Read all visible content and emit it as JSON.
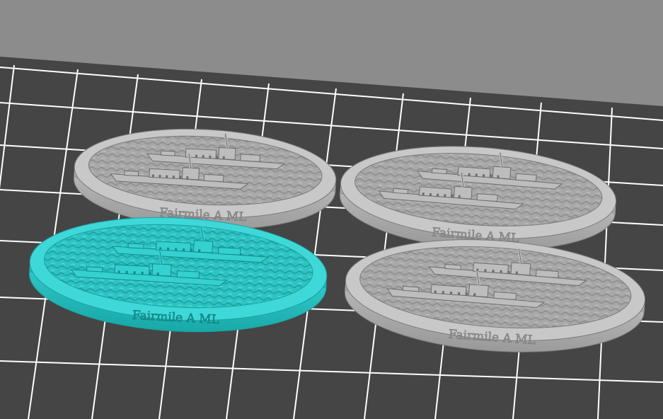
{
  "scene": {
    "background_color": "#8c8c8c",
    "bed_color": "#454545",
    "grid_color": "#ffffff",
    "model_color": "#b4b4b4",
    "selected_color": "#35d0d0"
  },
  "models": [
    {
      "name": "base-top-left",
      "label": "Fairmile A ML",
      "selected": false
    },
    {
      "name": "base-top-right",
      "label": "Fairmile A ML",
      "selected": false
    },
    {
      "name": "base-bottom-left",
      "label": "Fairmile A ML",
      "selected": true
    },
    {
      "name": "base-bottom-right",
      "label": "Fairmile A ML",
      "selected": false
    }
  ]
}
